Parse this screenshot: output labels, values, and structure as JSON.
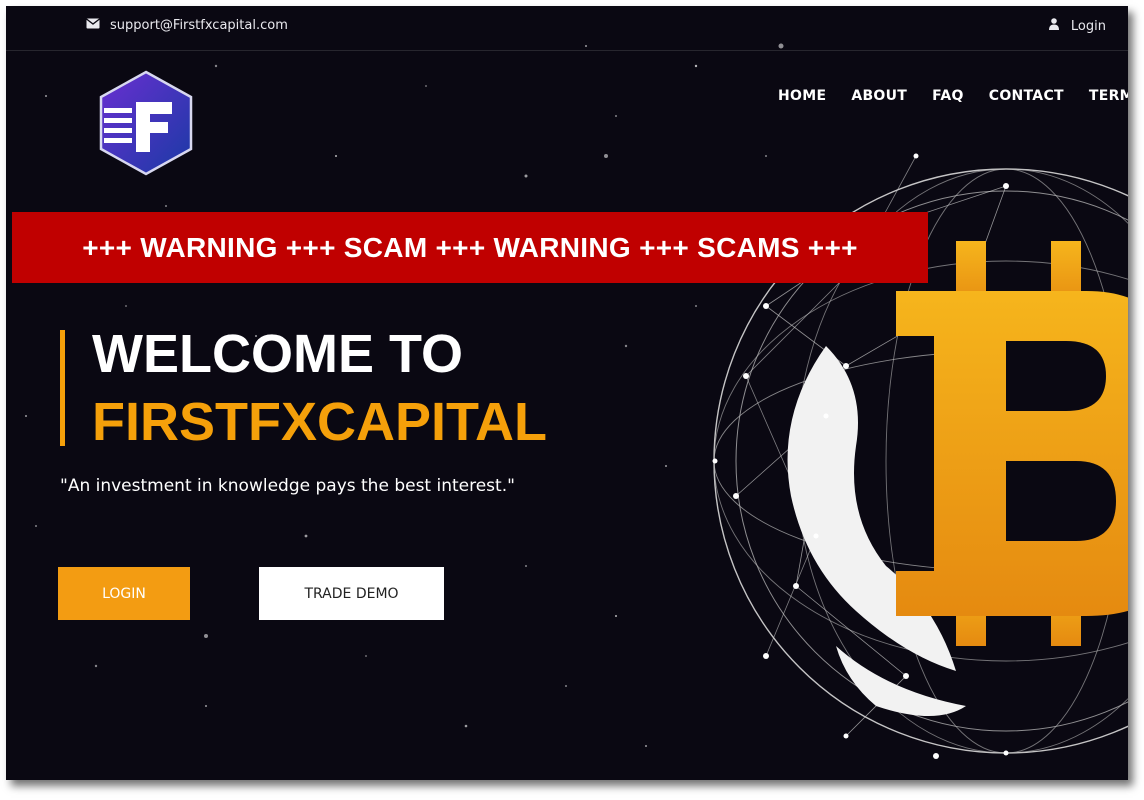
{
  "topbar": {
    "email_icon": "envelope-icon",
    "email": "support@Firstfxcapital.com",
    "login_icon": "user-icon",
    "login_label": "Login"
  },
  "logo": {
    "letter": "F"
  },
  "nav": {
    "items": [
      "HOME",
      "ABOUT",
      "FAQ",
      "CONTACT",
      "TERMS"
    ]
  },
  "warning_banner": "+++ WARNING +++ SCAM +++ WARNING +++ SCAMS +++",
  "hero": {
    "title_line1": "WELCOME TO",
    "title_line2": "FIRSTFXCAPITAL",
    "quote": "\"An investment in knowledge pays the best interest.\"",
    "login_button": "LOGIN",
    "demo_button": "TRADE DEMO"
  },
  "colors": {
    "background": "#0a0812",
    "accent": "#f5a00a",
    "warning": "#c00000",
    "logo_purple": "#5b2fc7",
    "logo_blue": "#1e3ea8"
  },
  "graphic": {
    "symbol": "bitcoin-symbol",
    "globe": "network-globe"
  }
}
